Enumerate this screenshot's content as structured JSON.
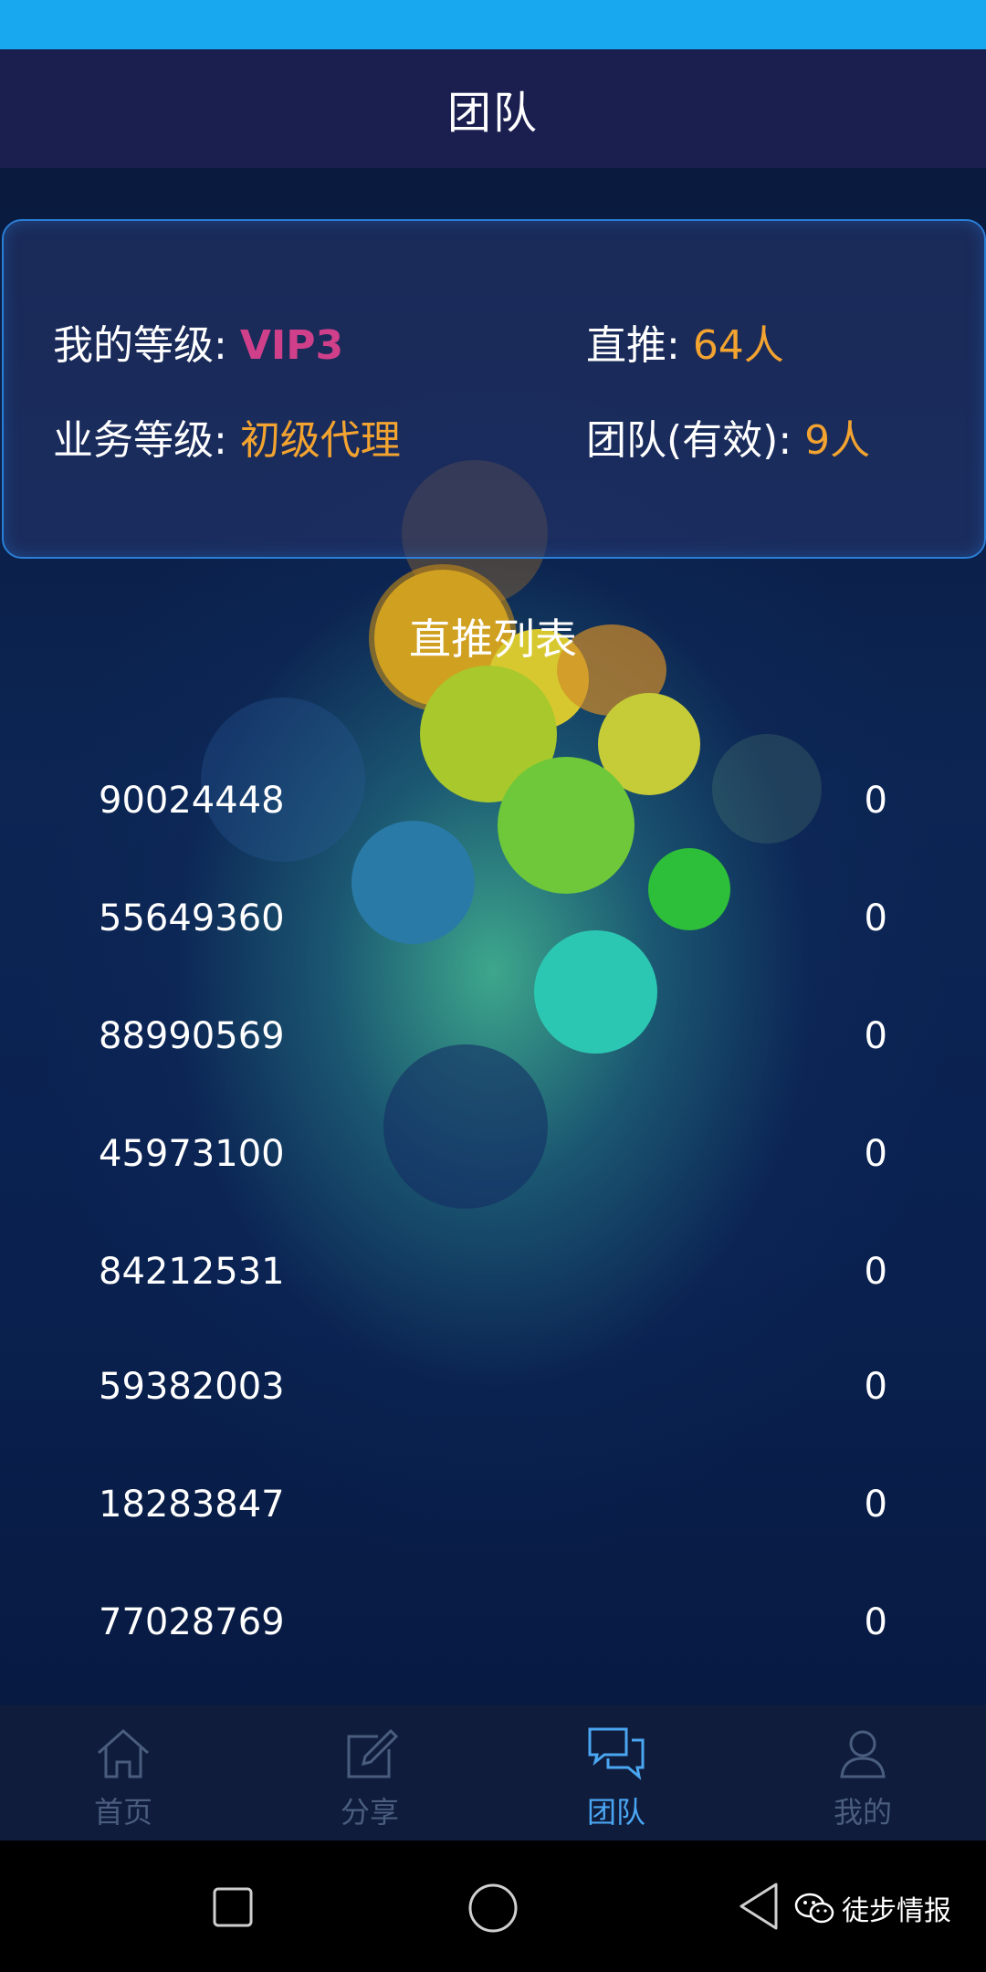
{
  "header": {
    "title": "团队"
  },
  "summary": {
    "my_level_label": "我的等级: ",
    "my_level_value": "VIP3",
    "direct_label": "直推: ",
    "direct_value": "64人",
    "business_level_label": "业务等级: ",
    "business_level_value": "初级代理",
    "team_label": "团队(有效): ",
    "team_value": "9人"
  },
  "list": {
    "title": "直推列表",
    "rows": [
      {
        "id": "90024448",
        "value": "0"
      },
      {
        "id": "55649360",
        "value": "0"
      },
      {
        "id": "88990569",
        "value": "0"
      },
      {
        "id": "45973100",
        "value": "0"
      },
      {
        "id": "84212531",
        "value": "0"
      },
      {
        "id": "59382003",
        "value": "0"
      },
      {
        "id": "18283847",
        "value": "0"
      },
      {
        "id": "77028769",
        "value": "0"
      }
    ]
  },
  "nav": {
    "items": [
      {
        "label": "首页",
        "icon": "home-icon",
        "active": false
      },
      {
        "label": "分享",
        "icon": "edit-icon",
        "active": false
      },
      {
        "label": "团队",
        "icon": "chat-icon",
        "active": true
      },
      {
        "label": "我的",
        "icon": "user-icon",
        "active": false
      }
    ]
  },
  "system_nav": {
    "buttons": [
      "recent-apps-icon",
      "home-circle-icon",
      "back-triangle-icon"
    ]
  },
  "watermark": {
    "text": "徒步情报",
    "icon": "wechat-icon"
  },
  "colors": {
    "status_bar": "#18a8f0",
    "header_bg": "#1a1f50",
    "accent_pink": "#d0408a",
    "accent_orange": "#f2a330",
    "nav_active": "#4ba6f2",
    "nav_inactive": "#4a5d7e"
  }
}
